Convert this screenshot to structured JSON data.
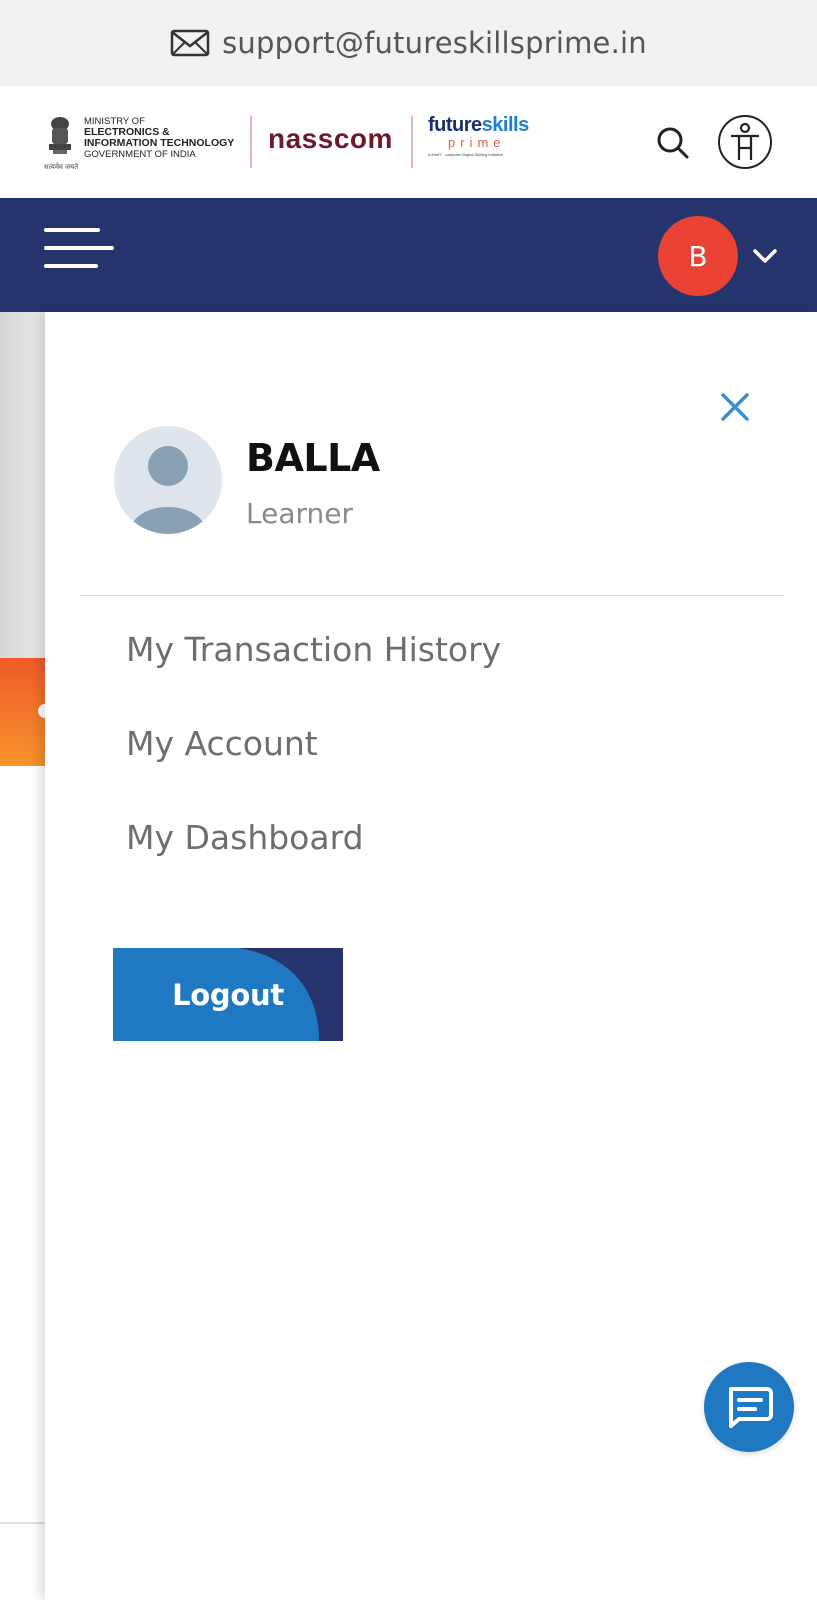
{
  "support_bar": {
    "email": "support@futureskillsprime.in",
    "icon": "mail-icon"
  },
  "logos": {
    "meity": {
      "line1": "MINISTRY OF",
      "line2": "ELECTRONICS &",
      "line3": "INFORMATION TECHNOLOGY",
      "line4": "GOVERNMENT OF INDIA",
      "emblem_caption": "सत्यमेव जयते"
    },
    "nasscom": "nasscom",
    "futureskills": {
      "part1": "future",
      "part2": "skills",
      "prime": "prime",
      "tagline": "A MeitY - nasscom Digital Skilling Initiative"
    }
  },
  "header": {
    "search_icon": "search-icon",
    "accessibility_icon": "accessibility-icon"
  },
  "nav": {
    "menu_icon": "hamburger-menu-icon",
    "avatar_initial": "B",
    "avatar_color": "#ea4335",
    "chevron_icon": "chevron-down-icon",
    "bar_color": "#26346d"
  },
  "drawer": {
    "close_icon": "close-icon",
    "profile": {
      "name": "BALLA",
      "role": "Learner",
      "avatar_icon": "user-avatar-icon"
    },
    "menu": [
      {
        "label": "My Transaction History"
      },
      {
        "label": "My Account"
      },
      {
        "label": "My Dashboard"
      }
    ],
    "logout_label": "Logout",
    "accent_color": "#1e78c2"
  },
  "chat": {
    "icon": "chat-icon"
  }
}
